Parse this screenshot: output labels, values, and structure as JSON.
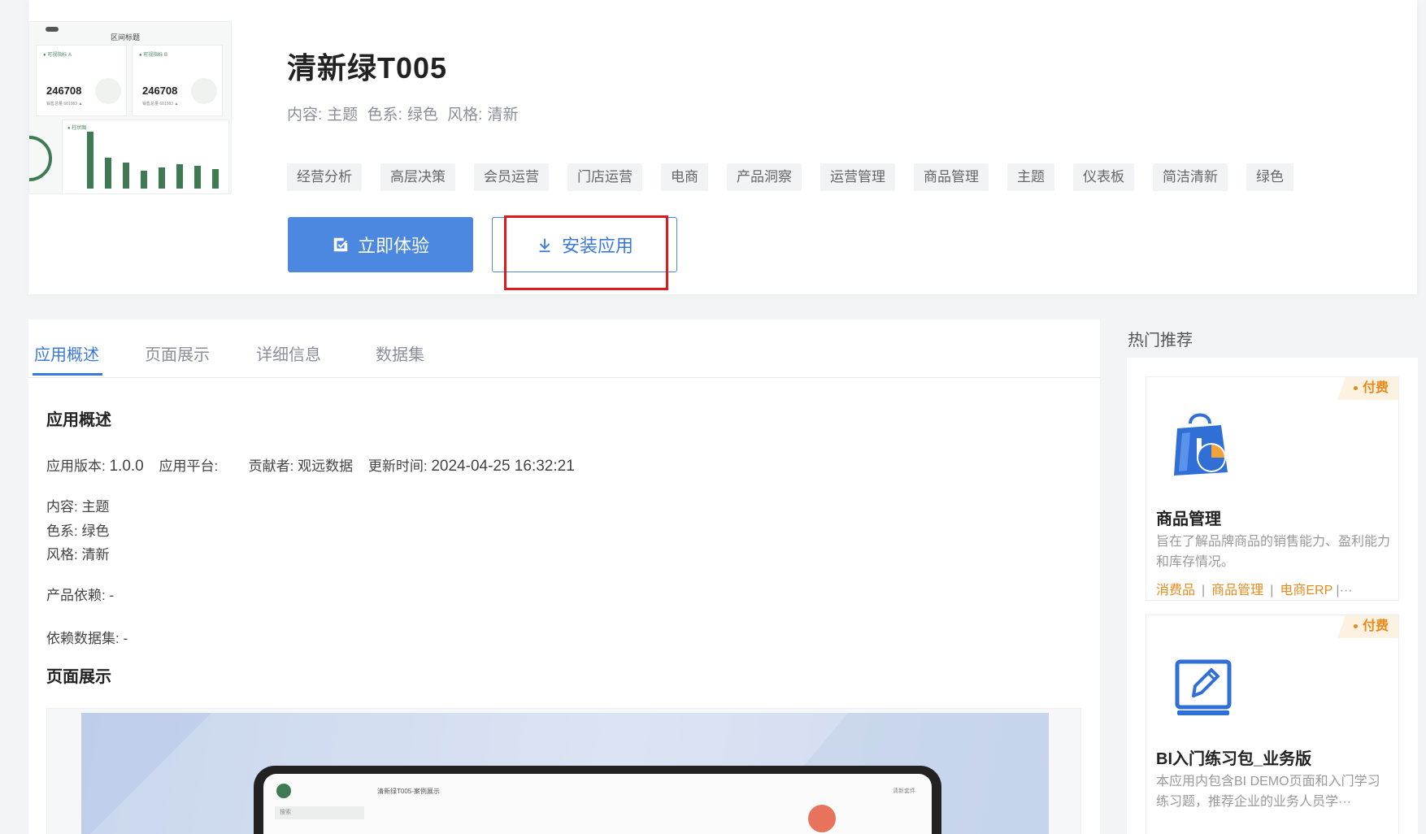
{
  "header": {
    "thumbnail": {
      "title": "区间标题",
      "kpis": [
        {
          "label": "● 可视指标 A",
          "value": "246708",
          "sub": "销售总量 681983 ▲"
        },
        {
          "label": "● 可视指标 B",
          "value": "246708",
          "sub": "销售总量 681983 ▲"
        }
      ],
      "chart_label": "● 柱状图"
    },
    "title": "清新绿T005",
    "meta": {
      "content_label": "内容:",
      "content_value": "主题",
      "color_label": "色系:",
      "color_value": "绿色",
      "style_label": "风格:",
      "style_value": "清新"
    },
    "tags": [
      "经营分析",
      "高层决策",
      "会员运营",
      "门店运营",
      "电商",
      "产品洞察",
      "运营管理",
      "商品管理",
      "主题",
      "仪表板",
      "简洁清新",
      "绿色"
    ],
    "primary_button": "立即体验",
    "secondary_button": "安装应用",
    "colors": {
      "primary": "#4d88e0",
      "highlight": "#e01a1a"
    }
  },
  "tabs": [
    {
      "label": "应用概述",
      "active": true
    },
    {
      "label": "页面展示",
      "active": false
    },
    {
      "label": "详细信息",
      "active": false
    },
    {
      "label": "数据集",
      "active": false
    }
  ],
  "overview": {
    "heading": "应用概述",
    "version_label": "应用版本:",
    "version_value": "1.0.0",
    "platform_label": "应用平台:",
    "platform_value": "",
    "contributor_label": "贡献者:",
    "contributor_value": "观远数据",
    "updated_label": "更新时间:",
    "updated_value": "2024-04-25 16:32:21",
    "content_line": "内容: 主题",
    "color_line": "色系: 绿色",
    "style_line": "风格: 清新",
    "dependency_line": "产品依赖: -",
    "dataset_dependency_line": "依赖数据集: -"
  },
  "page_display": {
    "heading": "页面展示",
    "screen_title": "清新绿T005-案例展示",
    "screen_search": "搜索",
    "screen_right": "清新套件"
  },
  "sidebar": {
    "heading": "热门推荐",
    "cards": [
      {
        "badge": "付费",
        "icon": "shopping-bag-pie-icon",
        "title": "商品管理",
        "desc": "旨在了解品牌商品的销售能力、盈利能力和库存情况。",
        "tags": [
          "消费品",
          "商品管理",
          "电商ERP"
        ],
        "more": "|···"
      },
      {
        "badge": "付费",
        "icon": "edit-pen-icon",
        "title": "BI入门练习包_业务版",
        "desc": "本应用内包含BI DEMO页面和入门学习练习题，推荐企业的业务人员学···"
      }
    ]
  }
}
